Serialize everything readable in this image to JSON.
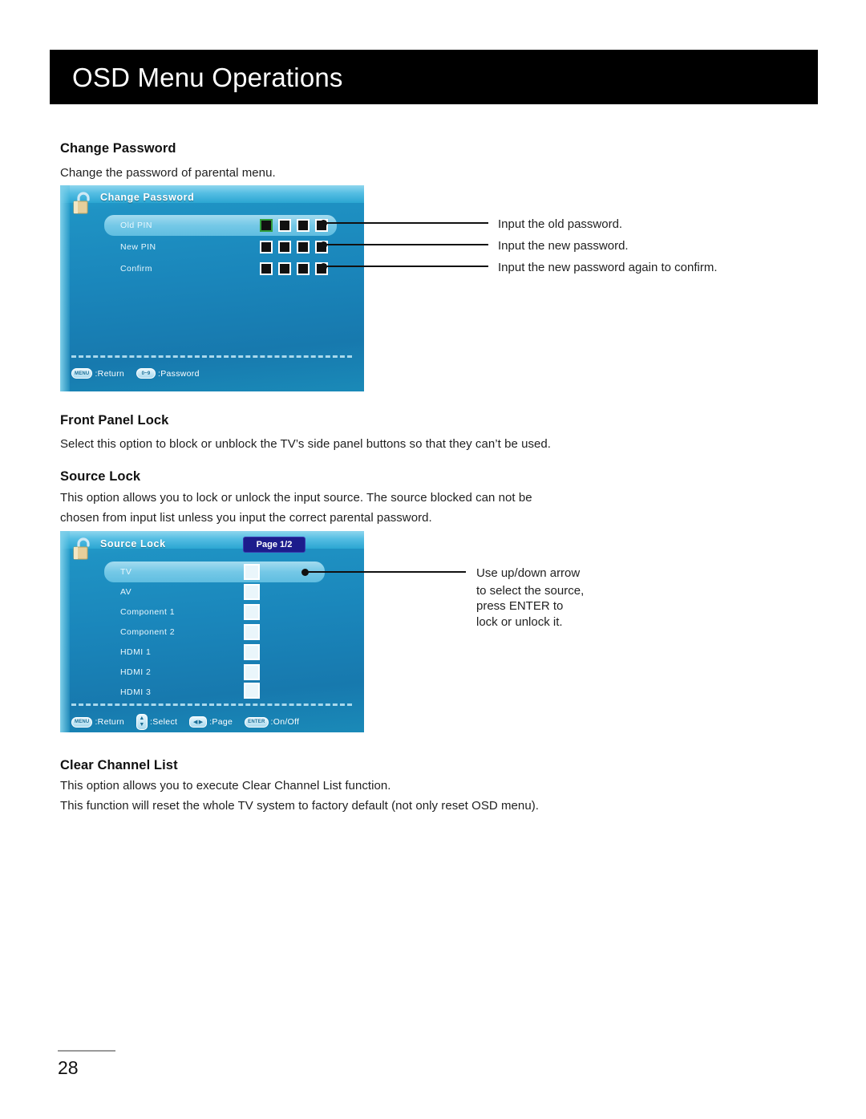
{
  "header": {
    "title": "OSD Menu Operations"
  },
  "sections": {
    "change_password": {
      "heading": "Change Password",
      "body": "Change the password of parental menu.",
      "osd": {
        "title": "Change Password",
        "icon": "open-padlock-icon",
        "rows": [
          {
            "label": "Old PIN",
            "selected": true
          },
          {
            "label": "New PIN",
            "selected": false
          },
          {
            "label": "Confirm",
            "selected": false
          }
        ],
        "pin_digits": 4,
        "focused_digit_index": 0,
        "focus_color": "#2f9e3c",
        "hints": [
          {
            "key": "MENU",
            "label": ":Return"
          },
          {
            "key": "0~9",
            "label": ":Password"
          }
        ]
      },
      "callouts": [
        "Input the old password.",
        "Input the new password.",
        "Input the new password again to confirm."
      ]
    },
    "front_panel_lock": {
      "heading": "Front Panel Lock",
      "body": [
        "Select this option to block or unblock the TV’s side panel buttons so that they can’t be used."
      ]
    },
    "source_lock": {
      "heading": "Source Lock",
      "body": [
        "This option allows you to lock or unlock the input source. The source blocked can not be",
        "chosen from input list unless you input the correct parental password."
      ],
      "osd": {
        "title": "Source Lock",
        "icon": "open-padlock-icon",
        "page_badge": "Page 1/2",
        "rows": [
          {
            "label": "TV",
            "selected": true,
            "checked": false
          },
          {
            "label": "AV",
            "selected": false,
            "checked": false
          },
          {
            "label": "Component 1",
            "selected": false,
            "checked": false
          },
          {
            "label": "Component 2",
            "selected": false,
            "checked": false
          },
          {
            "label": "HDMI 1",
            "selected": false,
            "checked": false
          },
          {
            "label": "HDMI 2",
            "selected": false,
            "checked": false
          },
          {
            "label": "HDMI 3",
            "selected": false,
            "checked": false
          }
        ],
        "hints": [
          {
            "key": "MENU",
            "label": ":Return"
          },
          {
            "key": "updown",
            "label": ":Select"
          },
          {
            "key": "leftright",
            "label": ":Page"
          },
          {
            "key": "ENTER",
            "label": ":On/Off"
          }
        ]
      },
      "callouts": [
        "Use up/down arrow",
        "to select the source,",
        "press ENTER to",
        "lock or unlock it."
      ]
    },
    "clear_channel_list": {
      "heading": "Clear Channel List",
      "body": [
        "This option allows you to execute Clear Channel List function.",
        "This function will reset the whole TV system to factory default (not only reset OSD menu)."
      ]
    }
  },
  "footer": {
    "page_number": "28"
  },
  "colors": {
    "header_bg": "#000000",
    "osd_blue": "#1a86bb",
    "highlight": "#8fd6ee",
    "badge_navy": "#1c1c8c",
    "focus_green": "#2f9e3c"
  }
}
